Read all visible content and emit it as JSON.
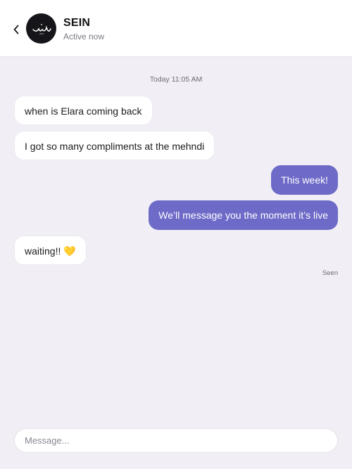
{
  "header": {
    "contact_name": "SEIN",
    "status": "Active now"
  },
  "conversation": {
    "timestamp": "Today 11:05 AM",
    "messages": [
      {
        "direction": "incoming",
        "text": "when is Elara coming back"
      },
      {
        "direction": "incoming",
        "text": "I got so many compliments at the mehndi"
      },
      {
        "direction": "outgoing",
        "text": "This week!"
      },
      {
        "direction": "outgoing",
        "text": "We’ll message you the moment it’s live"
      },
      {
        "direction": "incoming",
        "text": "waiting!! 💛"
      }
    ],
    "read_receipt": "Seen"
  },
  "composer": {
    "placeholder": "Message..."
  },
  "colors": {
    "outgoing_bubble": "#6e6ac8",
    "incoming_bubble": "#ffffff",
    "background": "#f1eff5"
  },
  "icons": {
    "back": "chevron-left-icon",
    "avatar": "brand-logo"
  }
}
